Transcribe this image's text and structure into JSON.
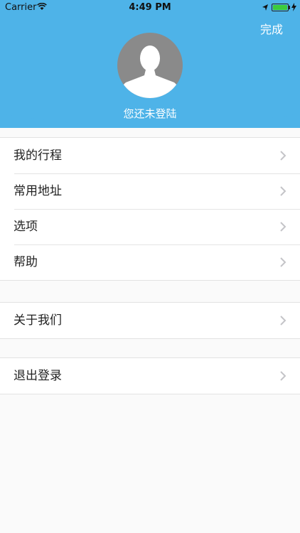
{
  "status_bar": {
    "carrier": "Carrier",
    "time": "4:49 PM",
    "battery_level": 1.0,
    "icons": [
      "wifi-icon",
      "location-arrow-icon",
      "battery-icon",
      "charging-bolt-icon"
    ]
  },
  "header": {
    "done_label": "完成",
    "login_status": "您还未登陆",
    "avatar_icon": "default-user-avatar",
    "background_color": "#4eb3e8"
  },
  "menu": {
    "group1": [
      {
        "label": "我的行程"
      },
      {
        "label": "常用地址"
      },
      {
        "label": "选项"
      },
      {
        "label": "帮助"
      }
    ],
    "group2": [
      {
        "label": "关于我们"
      }
    ],
    "group3": [
      {
        "label": "退出登录"
      }
    ]
  }
}
